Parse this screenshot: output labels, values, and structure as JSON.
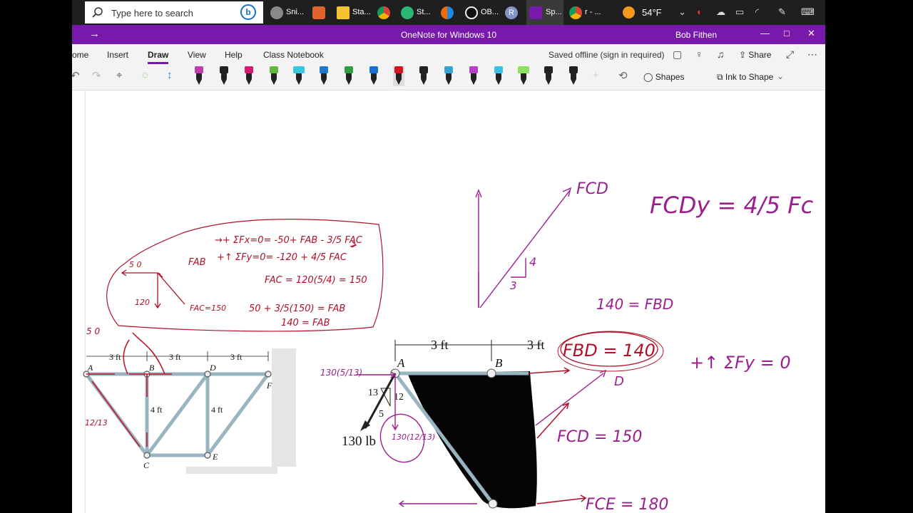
{
  "taskbar": {
    "search_placeholder": "Type here to search",
    "apps": [
      {
        "label": "Sni...",
        "icon": "snipping-tool-icon"
      },
      {
        "label": "",
        "icon": "paint-icon"
      },
      {
        "label": "Sta...",
        "icon": "sticky-notes-icon"
      },
      {
        "label": "",
        "icon": "chrome-icon"
      },
      {
        "label": "St...",
        "icon": "app-icon"
      },
      {
        "label": "",
        "icon": "app-icon"
      },
      {
        "label": "OB...",
        "icon": "obs-icon"
      },
      {
        "label": "R",
        "icon": "profile-icon"
      },
      {
        "label": "Sp...",
        "icon": "onenote-icon"
      },
      {
        "label": "r - ...",
        "icon": "chrome-profile-icon"
      }
    ],
    "weather": "54°F"
  },
  "titlebar": {
    "title": "OneNote for Windows 10",
    "user": "Bob Fithen"
  },
  "menu": {
    "items": [
      "ome",
      "Insert",
      "Draw",
      "View",
      "Help",
      "Class Notebook"
    ],
    "active": "Draw",
    "status": "Saved offline (sign in required)",
    "share": "Share"
  },
  "toolbar": {
    "shapes_label": "Shapes",
    "ink_to_shape_label": "Ink to Shape",
    "pen_colors": [
      "#c43bb0",
      "#222222",
      "#d8176e",
      "#5fb83b",
      "#38c8e0",
      "#2277cc",
      "#2e9e3e",
      "#1b6fcf",
      "#d6141e",
      "#222222",
      "#36a3d6",
      "#b43fc2",
      "#38c0e8",
      "#8ee060",
      "#222222",
      "#222222"
    ]
  },
  "page": {
    "notes": {
      "sum_fx": "→+ ΣFx=0= -50+ FAB - 3/5 FAC",
      "sum_fy": "+↑ ΣFy=0= -120 + 4/5 FAC",
      "fab": "FAB",
      "fac": "FAC = 120(5/4) = 150",
      "f50": "5 0",
      "f120": "120",
      "fac_lbl": "FAC=150",
      "eq_fab": "50 + 3/5(150) = FAB",
      "fab_140": "140 = FAB",
      "fcd": "FCD",
      "fcdy": "FCDy = 4/5 Fc",
      "tri_4": "4",
      "tri_3": "3",
      "fbd_eq": "140 = FBD",
      "fbd_circ": "FBD = 140",
      "sum_fy0": "+↑ ΣFy = 0",
      "d": "D",
      "fcd150": "FCD = 150",
      "fce180": "FCE = 180",
      "f130": "130(5/13)",
      "f130b": "130(12/13)",
      "l5": "5 0",
      "l12": "12/13"
    },
    "truss": {
      "labels": [
        "A",
        "B",
        "C",
        "D",
        "E",
        "F"
      ],
      "dim": "3 ft",
      "height": "4 ft"
    },
    "big_diagram": {
      "dim1": "3 ft",
      "dim2": "3 ft",
      "a": "A",
      "b": "B",
      "n13": "13",
      "n12": "12",
      "n5": "5",
      "load": "130 lb"
    }
  }
}
